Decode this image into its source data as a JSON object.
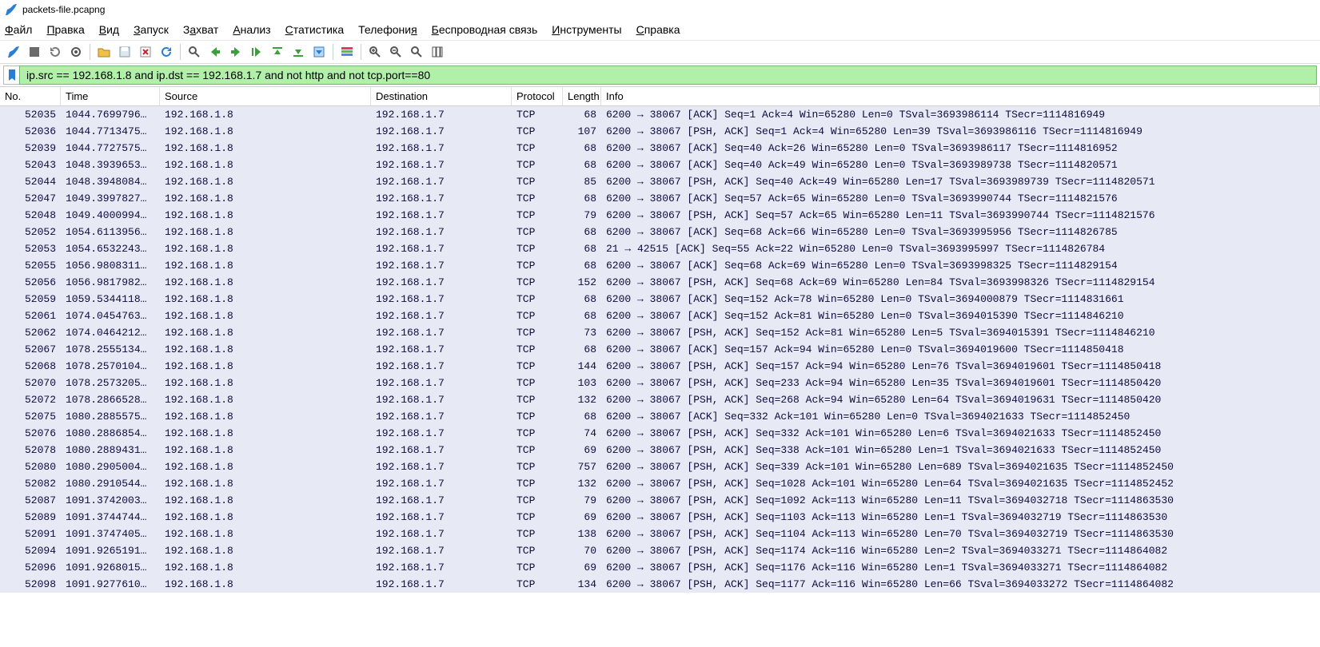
{
  "window": {
    "title": "packets-file.pcapng"
  },
  "menu": {
    "file": {
      "pre": "",
      "u": "Ф",
      "post": "айл"
    },
    "edit": {
      "pre": "",
      "u": "П",
      "post": "равка"
    },
    "view": {
      "pre": "",
      "u": "В",
      "post": "ид"
    },
    "go": {
      "pre": "",
      "u": "З",
      "post": "апуск"
    },
    "capture": {
      "pre": "З",
      "u": "а",
      "post": "хват"
    },
    "analyze": {
      "pre": "",
      "u": "А",
      "post": "нализ"
    },
    "stats": {
      "pre": "",
      "u": "С",
      "post": "татистика"
    },
    "tel": {
      "pre": "Телефони",
      "u": "я",
      "post": ""
    },
    "wireless": {
      "pre": "",
      "u": "Б",
      "post": "еспроводная связь"
    },
    "tools": {
      "pre": "",
      "u": "И",
      "post": "нструменты"
    },
    "help": {
      "pre": "",
      "u": "С",
      "post": "правка"
    }
  },
  "filter": {
    "value": "ip.src == 192.168.1.8 and ip.dst == 192.168.1.7 and not http and not tcp.port==80"
  },
  "columns": {
    "no": "No.",
    "time": "Time",
    "source": "Source",
    "destination": "Destination",
    "protocol": "Protocol",
    "length": "Length",
    "info": "Info"
  },
  "packets": [
    {
      "no": "52035",
      "time": "1044.7699796…",
      "src": "192.168.1.8",
      "dst": "192.168.1.7",
      "proto": "TCP",
      "len": "68",
      "info": "6200 → 38067 [ACK] Seq=1 Ack=4 Win=65280 Len=0 TSval=3693986114 TSecr=1114816949"
    },
    {
      "no": "52036",
      "time": "1044.7713475…",
      "src": "192.168.1.8",
      "dst": "192.168.1.7",
      "proto": "TCP",
      "len": "107",
      "info": "6200 → 38067 [PSH, ACK] Seq=1 Ack=4 Win=65280 Len=39 TSval=3693986116 TSecr=1114816949"
    },
    {
      "no": "52039",
      "time": "1044.7727575…",
      "src": "192.168.1.8",
      "dst": "192.168.1.7",
      "proto": "TCP",
      "len": "68",
      "info": "6200 → 38067 [ACK] Seq=40 Ack=26 Win=65280 Len=0 TSval=3693986117 TSecr=1114816952"
    },
    {
      "no": "52043",
      "time": "1048.3939653…",
      "src": "192.168.1.8",
      "dst": "192.168.1.7",
      "proto": "TCP",
      "len": "68",
      "info": "6200 → 38067 [ACK] Seq=40 Ack=49 Win=65280 Len=0 TSval=3693989738 TSecr=1114820571"
    },
    {
      "no": "52044",
      "time": "1048.3948084…",
      "src": "192.168.1.8",
      "dst": "192.168.1.7",
      "proto": "TCP",
      "len": "85",
      "info": "6200 → 38067 [PSH, ACK] Seq=40 Ack=49 Win=65280 Len=17 TSval=3693989739 TSecr=1114820571"
    },
    {
      "no": "52047",
      "time": "1049.3997827…",
      "src": "192.168.1.8",
      "dst": "192.168.1.7",
      "proto": "TCP",
      "len": "68",
      "info": "6200 → 38067 [ACK] Seq=57 Ack=65 Win=65280 Len=0 TSval=3693990744 TSecr=1114821576"
    },
    {
      "no": "52048",
      "time": "1049.4000994…",
      "src": "192.168.1.8",
      "dst": "192.168.1.7",
      "proto": "TCP",
      "len": "79",
      "info": "6200 → 38067 [PSH, ACK] Seq=57 Ack=65 Win=65280 Len=11 TSval=3693990744 TSecr=1114821576"
    },
    {
      "no": "52052",
      "time": "1054.6113956…",
      "src": "192.168.1.8",
      "dst": "192.168.1.7",
      "proto": "TCP",
      "len": "68",
      "info": "6200 → 38067 [ACK] Seq=68 Ack=66 Win=65280 Len=0 TSval=3693995956 TSecr=1114826785"
    },
    {
      "no": "52053",
      "time": "1054.6532243…",
      "src": "192.168.1.8",
      "dst": "192.168.1.7",
      "proto": "TCP",
      "len": "68",
      "info": "21 → 42515 [ACK] Seq=55 Ack=22 Win=65280 Len=0 TSval=3693995997 TSecr=1114826784"
    },
    {
      "no": "52055",
      "time": "1056.9808311…",
      "src": "192.168.1.8",
      "dst": "192.168.1.7",
      "proto": "TCP",
      "len": "68",
      "info": "6200 → 38067 [ACK] Seq=68 Ack=69 Win=65280 Len=0 TSval=3693998325 TSecr=1114829154"
    },
    {
      "no": "52056",
      "time": "1056.9817982…",
      "src": "192.168.1.8",
      "dst": "192.168.1.7",
      "proto": "TCP",
      "len": "152",
      "info": "6200 → 38067 [PSH, ACK] Seq=68 Ack=69 Win=65280 Len=84 TSval=3693998326 TSecr=1114829154"
    },
    {
      "no": "52059",
      "time": "1059.5344118…",
      "src": "192.168.1.8",
      "dst": "192.168.1.7",
      "proto": "TCP",
      "len": "68",
      "info": "6200 → 38067 [ACK] Seq=152 Ack=78 Win=65280 Len=0 TSval=3694000879 TSecr=1114831661"
    },
    {
      "no": "52061",
      "time": "1074.0454763…",
      "src": "192.168.1.8",
      "dst": "192.168.1.7",
      "proto": "TCP",
      "len": "68",
      "info": "6200 → 38067 [ACK] Seq=152 Ack=81 Win=65280 Len=0 TSval=3694015390 TSecr=1114846210"
    },
    {
      "no": "52062",
      "time": "1074.0464212…",
      "src": "192.168.1.8",
      "dst": "192.168.1.7",
      "proto": "TCP",
      "len": "73",
      "info": "6200 → 38067 [PSH, ACK] Seq=152 Ack=81 Win=65280 Len=5 TSval=3694015391 TSecr=1114846210"
    },
    {
      "no": "52067",
      "time": "1078.2555134…",
      "src": "192.168.1.8",
      "dst": "192.168.1.7",
      "proto": "TCP",
      "len": "68",
      "info": "6200 → 38067 [ACK] Seq=157 Ack=94 Win=65280 Len=0 TSval=3694019600 TSecr=1114850418"
    },
    {
      "no": "52068",
      "time": "1078.2570104…",
      "src": "192.168.1.8",
      "dst": "192.168.1.7",
      "proto": "TCP",
      "len": "144",
      "info": "6200 → 38067 [PSH, ACK] Seq=157 Ack=94 Win=65280 Len=76 TSval=3694019601 TSecr=1114850418"
    },
    {
      "no": "52070",
      "time": "1078.2573205…",
      "src": "192.168.1.8",
      "dst": "192.168.1.7",
      "proto": "TCP",
      "len": "103",
      "info": "6200 → 38067 [PSH, ACK] Seq=233 Ack=94 Win=65280 Len=35 TSval=3694019601 TSecr=1114850420"
    },
    {
      "no": "52072",
      "time": "1078.2866528…",
      "src": "192.168.1.8",
      "dst": "192.168.1.7",
      "proto": "TCP",
      "len": "132",
      "info": "6200 → 38067 [PSH, ACK] Seq=268 Ack=94 Win=65280 Len=64 TSval=3694019631 TSecr=1114850420"
    },
    {
      "no": "52075",
      "time": "1080.2885575…",
      "src": "192.168.1.8",
      "dst": "192.168.1.7",
      "proto": "TCP",
      "len": "68",
      "info": "6200 → 38067 [ACK] Seq=332 Ack=101 Win=65280 Len=0 TSval=3694021633 TSecr=1114852450"
    },
    {
      "no": "52076",
      "time": "1080.2886854…",
      "src": "192.168.1.8",
      "dst": "192.168.1.7",
      "proto": "TCP",
      "len": "74",
      "info": "6200 → 38067 [PSH, ACK] Seq=332 Ack=101 Win=65280 Len=6 TSval=3694021633 TSecr=1114852450"
    },
    {
      "no": "52078",
      "time": "1080.2889431…",
      "src": "192.168.1.8",
      "dst": "192.168.1.7",
      "proto": "TCP",
      "len": "69",
      "info": "6200 → 38067 [PSH, ACK] Seq=338 Ack=101 Win=65280 Len=1 TSval=3694021633 TSecr=1114852450"
    },
    {
      "no": "52080",
      "time": "1080.2905004…",
      "src": "192.168.1.8",
      "dst": "192.168.1.7",
      "proto": "TCP",
      "len": "757",
      "info": "6200 → 38067 [PSH, ACK] Seq=339 Ack=101 Win=65280 Len=689 TSval=3694021635 TSecr=1114852450"
    },
    {
      "no": "52082",
      "time": "1080.2910544…",
      "src": "192.168.1.8",
      "dst": "192.168.1.7",
      "proto": "TCP",
      "len": "132",
      "info": "6200 → 38067 [PSH, ACK] Seq=1028 Ack=101 Win=65280 Len=64 TSval=3694021635 TSecr=1114852452"
    },
    {
      "no": "52087",
      "time": "1091.3742003…",
      "src": "192.168.1.8",
      "dst": "192.168.1.7",
      "proto": "TCP",
      "len": "79",
      "info": "6200 → 38067 [PSH, ACK] Seq=1092 Ack=113 Win=65280 Len=11 TSval=3694032718 TSecr=1114863530"
    },
    {
      "no": "52089",
      "time": "1091.3744744…",
      "src": "192.168.1.8",
      "dst": "192.168.1.7",
      "proto": "TCP",
      "len": "69",
      "info": "6200 → 38067 [PSH, ACK] Seq=1103 Ack=113 Win=65280 Len=1 TSval=3694032719 TSecr=1114863530"
    },
    {
      "no": "52091",
      "time": "1091.3747405…",
      "src": "192.168.1.8",
      "dst": "192.168.1.7",
      "proto": "TCP",
      "len": "138",
      "info": "6200 → 38067 [PSH, ACK] Seq=1104 Ack=113 Win=65280 Len=70 TSval=3694032719 TSecr=1114863530"
    },
    {
      "no": "52094",
      "time": "1091.9265191…",
      "src": "192.168.1.8",
      "dst": "192.168.1.7",
      "proto": "TCP",
      "len": "70",
      "info": "6200 → 38067 [PSH, ACK] Seq=1174 Ack=116 Win=65280 Len=2 TSval=3694033271 TSecr=1114864082"
    },
    {
      "no": "52096",
      "time": "1091.9268015…",
      "src": "192.168.1.8",
      "dst": "192.168.1.7",
      "proto": "TCP",
      "len": "69",
      "info": "6200 → 38067 [PSH, ACK] Seq=1176 Ack=116 Win=65280 Len=1 TSval=3694033271 TSecr=1114864082"
    },
    {
      "no": "52098",
      "time": "1091.9277610…",
      "src": "192.168.1.8",
      "dst": "192.168.1.7",
      "proto": "TCP",
      "len": "134",
      "info": "6200 → 38067 [PSH, ACK] Seq=1177 Ack=116 Win=65280 Len=66 TSval=3694033272 TSecr=1114864082"
    }
  ]
}
